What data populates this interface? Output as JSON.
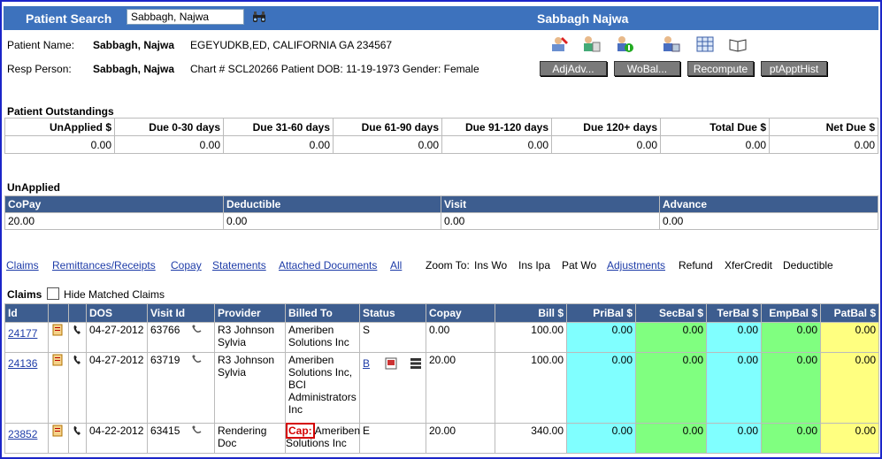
{
  "header": {
    "search_label": "Patient Search",
    "search_value": "Sabbagh, Najwa",
    "patient_display": "Sabbagh Najwa"
  },
  "patient": {
    "name_label": "Patient Name:",
    "name": "Sabbagh, Najwa",
    "address": "EGEYUDKB,ED, CALIFORNIA GA 234567",
    "resp_label": "Resp Person:",
    "resp": "Sabbagh, Najwa",
    "chart_line": "Chart # SCL20266 Patient DOB: 11-19-1973 Gender: Female"
  },
  "actions": [
    "AdjAdv...",
    "WoBal...",
    "Recompute",
    "ptApptHist"
  ],
  "outstandings": {
    "title": "Patient Outstandings",
    "headers": [
      "UnApplied $",
      "Due 0-30 days",
      "Due 31-60 days",
      "Due 61-90 days",
      "Due 91-120 days",
      "Due 120+ days",
      "Total Due $",
      "Net Due $"
    ],
    "values": [
      "0.00",
      "0.00",
      "0.00",
      "0.00",
      "0.00",
      "0.00",
      "0.00",
      "0.00"
    ]
  },
  "unapplied": {
    "title": "UnApplied",
    "headers": [
      "CoPay",
      "Deductible",
      "Visit",
      "Advance"
    ],
    "values": [
      "20.00",
      "0.00",
      "0.00",
      "0.00"
    ]
  },
  "links": {
    "claims": "Claims",
    "remittances": "Remittances/Receipts",
    "copay": "Copay",
    "statements": "Statements",
    "attached": "Attached Documents",
    "all": "All",
    "zoom_label": "Zoom To:",
    "ins_wo": "Ins Wo",
    "ins_ipa": "Ins Ipa",
    "pat_wo": "Pat Wo",
    "adjustments": "Adjustments",
    "refund": "Refund",
    "xfercredit": "XferCredit",
    "deductible": "Deductible"
  },
  "claims": {
    "title": "Claims",
    "hide_label": "Hide Matched Claims",
    "headers": [
      "Id",
      "DOS",
      "Visit Id",
      "Provider",
      "Billed To",
      "Status",
      "Copay",
      "Bill $",
      "PriBal $",
      "SecBal $",
      "TerBal $",
      "EmpBal $",
      "PatBal $"
    ],
    "rows": [
      {
        "id": "24177",
        "dos": "04-27-2012",
        "visit": "63766",
        "provider": "R3 Johnson Sylvia",
        "billed": "Ameriben Solutions Inc",
        "status": "S",
        "copay": "0.00",
        "bill": "100.00",
        "pri": "0.00",
        "sec": "0.00",
        "ter": "0.00",
        "emp": "0.00",
        "pat": "0.00"
      },
      {
        "id": "24136",
        "dos": "04-27-2012",
        "visit": "63719",
        "provider": "R3 Johnson Sylvia",
        "billed": "Ameriben Solutions Inc, BCI Administrators Inc",
        "status": "B",
        "copay": "20.00",
        "bill": "100.00",
        "pri": "0.00",
        "sec": "0.00",
        "ter": "0.00",
        "emp": "0.00",
        "pat": "0.00"
      },
      {
        "id": "23852",
        "dos": "04-22-2012",
        "visit": "63415",
        "provider": "Rendering Doc",
        "cap": "Cap:",
        "billed": "Ameriben Solutions Inc",
        "status": "E",
        "copay": "20.00",
        "bill": "340.00",
        "pri": "0.00",
        "sec": "0.00",
        "ter": "0.00",
        "emp": "0.00",
        "pat": "0.00"
      }
    ]
  },
  "colors": {
    "header_bg": "#3d72bd",
    "table_header_bg": "#3d5d8f",
    "pri": "#80ffff",
    "sec": "#80ff80",
    "pat": "#ffff80",
    "border": "#1b25c8"
  }
}
